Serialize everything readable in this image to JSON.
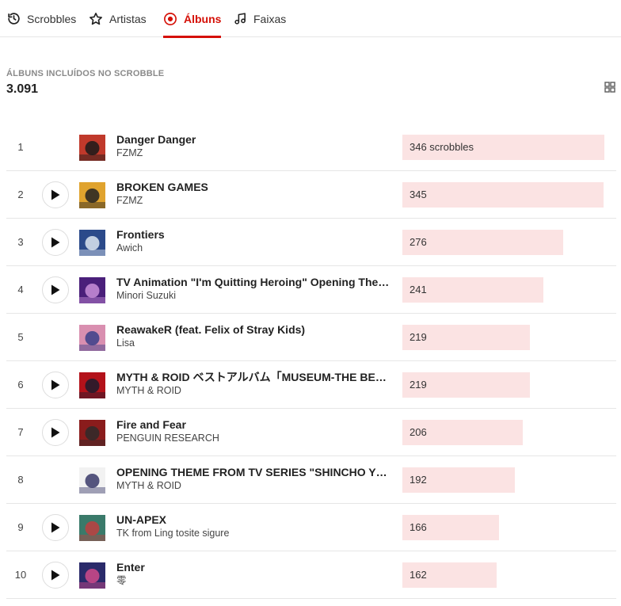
{
  "tabs": [
    {
      "label": "Scrobbles",
      "icon": "history-icon",
      "active": false
    },
    {
      "label": "Artistas",
      "icon": "star-icon",
      "active": false
    },
    {
      "label": "Álbuns",
      "icon": "record-icon",
      "active": true
    },
    {
      "label": "Faixas",
      "icon": "music-note-icon",
      "active": false
    }
  ],
  "header": {
    "label": "ÁLBUNS INCLUÍDOS NO SCROBBLE",
    "count": "3.091",
    "view_toggle_icon": "grid-view-icon"
  },
  "colors": {
    "accent": "#d51007",
    "bar": "#fbe3e3",
    "divider": "#e6e6e6"
  },
  "max_scrobbles": 346,
  "albums": [
    {
      "rank": "1",
      "title": "Danger Danger",
      "artist": "FZMZ",
      "scrobbles": 346,
      "count_label": "346 scrobbles",
      "play_button": false,
      "cover_colors": [
        "#c0392b",
        "#1a1a1a"
      ]
    },
    {
      "rank": "2",
      "title": "BROKEN GAMES",
      "artist": "FZMZ",
      "scrobbles": 345,
      "count_label": "345",
      "play_button": true,
      "cover_colors": [
        "#e0a32e",
        "#222222"
      ]
    },
    {
      "rank": "3",
      "title": "Frontiers",
      "artist": "Awich",
      "scrobbles": 276,
      "count_label": "276",
      "play_button": true,
      "cover_colors": [
        "#2b4a8a",
        "#dde6f0"
      ]
    },
    {
      "rank": "4",
      "title": "TV Animation \"I'm Quitting Heroing\" Opening Theme S...",
      "artist": "Minori Suzuki",
      "scrobbles": 241,
      "count_label": "241",
      "play_button": true,
      "cover_colors": [
        "#4a1f7a",
        "#c98fd9"
      ]
    },
    {
      "rank": "5",
      "title": "ReawakeR (feat. Felix of Stray Kids)",
      "artist": "Lisa",
      "scrobbles": 219,
      "count_label": "219",
      "play_button": false,
      "cover_colors": [
        "#d98fb0",
        "#3a3f8a"
      ]
    },
    {
      "rank": "6",
      "title": "MYTH & ROID ベストアルバム「MUSEUM-THE BEST O...",
      "artist": "MYTH & ROID",
      "scrobbles": 219,
      "count_label": "219",
      "play_button": true,
      "cover_colors": [
        "#b3121a",
        "#1c1c2e"
      ]
    },
    {
      "rank": "7",
      "title": "Fire and Fear",
      "artist": "PENGUIN RESEARCH",
      "scrobbles": 206,
      "count_label": "206",
      "play_button": true,
      "cover_colors": [
        "#8a1c1c",
        "#2e2a2a"
      ]
    },
    {
      "rank": "8",
      "title": "OPENING THEME FROM TV SERIES \"SHINCHO YUSHA\"",
      "artist": "MYTH & ROID",
      "scrobbles": 192,
      "count_label": "192",
      "play_button": false,
      "cover_colors": [
        "#f2f2f2",
        "#3a3a6a"
      ]
    },
    {
      "rank": "9",
      "title": "UN-APEX",
      "artist": "TK from Ling tosite sigure",
      "scrobbles": 166,
      "count_label": "166",
      "play_button": true,
      "cover_colors": [
        "#3a7a6a",
        "#c04040"
      ]
    },
    {
      "rank": "10",
      "title": "Enter",
      "artist": "零",
      "scrobbles": 162,
      "count_label": "162",
      "play_button": true,
      "cover_colors": [
        "#2a2a6a",
        "#d04a8a"
      ]
    }
  ]
}
